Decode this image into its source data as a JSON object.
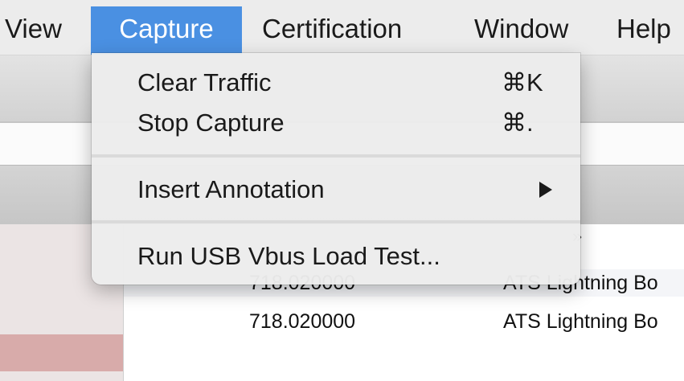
{
  "menubar": {
    "items": [
      {
        "label": "View"
      },
      {
        "label": "Capture"
      },
      {
        "label": "Certification"
      },
      {
        "label": "Window"
      },
      {
        "label": "Help"
      }
    ]
  },
  "capture_menu": {
    "items": [
      {
        "label": "Clear Traffic",
        "shortcut": "⌘K"
      },
      {
        "label": "Stop Capture",
        "shortcut": "⌘."
      },
      {
        "label": "Insert Annotation",
        "submenu_icon": "triangle-right-icon"
      },
      {
        "label": "Run USB Vbus Load Test..."
      }
    ]
  },
  "traffic_table": {
    "rows": [
      {
        "time": "718.020000",
        "name": "ATS Lightning Bo"
      },
      {
        "time": "718.020000",
        "name": "ATS Lightning Bo"
      }
    ]
  },
  "colors": {
    "menu_highlight": "#4a90e2",
    "selected_row": "#d8abaa"
  }
}
